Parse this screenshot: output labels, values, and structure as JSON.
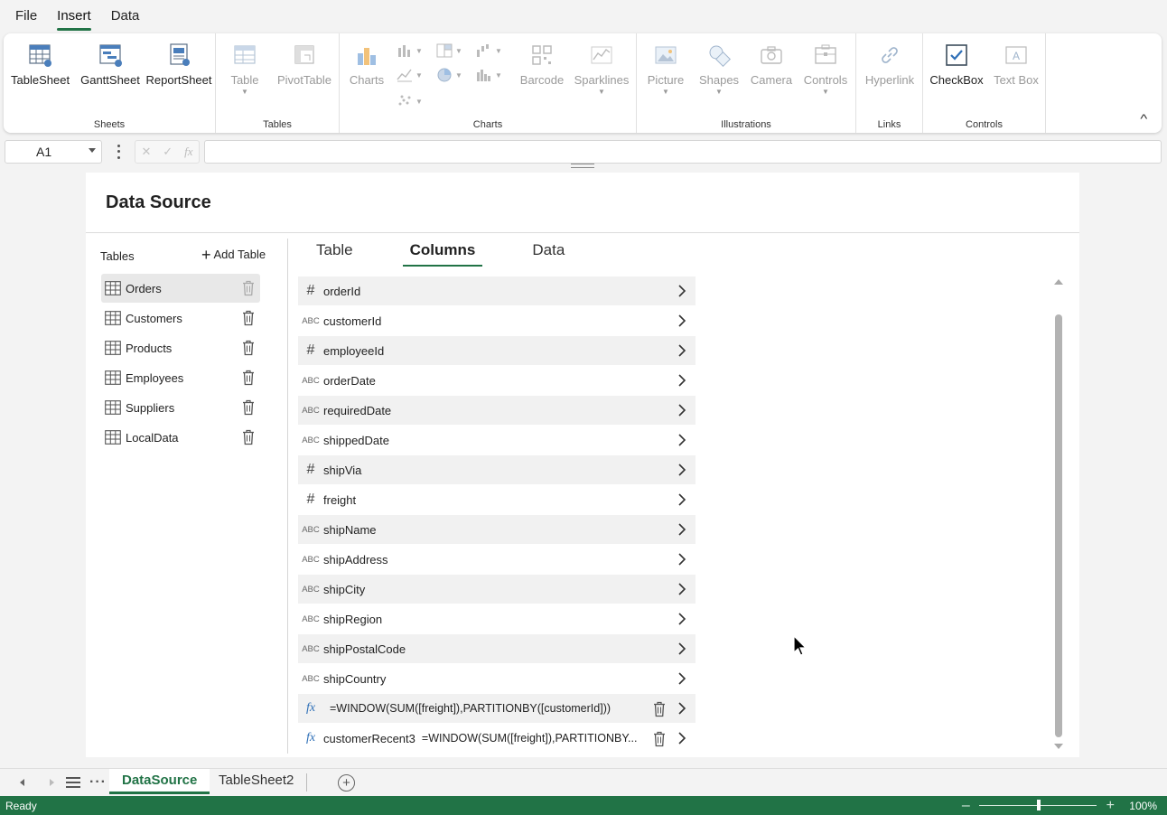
{
  "menu": [
    "File",
    "Insert",
    "Data"
  ],
  "ribbon": {
    "sheets": {
      "group": "Sheets",
      "tablesheet": "TableSheet",
      "ganttsheet": "GanttSheet",
      "reportsheet": "ReportSheet"
    },
    "tables": {
      "group": "Tables",
      "table": "Table",
      "pivottable": "PivotTable"
    },
    "charts": {
      "group": "Charts",
      "charts": "Charts",
      "barcode": "Barcode",
      "sparklines": "Sparklines"
    },
    "illustrations": {
      "group": "Illustrations",
      "picture": "Picture",
      "shapes": "Shapes",
      "camera": "Camera",
      "controls": "Controls"
    },
    "links": {
      "group": "Links",
      "hyperlink": "Hyperlink"
    },
    "controls": {
      "group": "Controls",
      "checkbox": "CheckBox",
      "textbox": "Text Box"
    },
    "collapse_icon": "chevron-up-icon"
  },
  "formula_bar": {
    "cell_ref": "A1",
    "formula": ""
  },
  "data_source": {
    "title": "Data Source",
    "tables_label": "Tables",
    "add_table": "Add Table",
    "tables": [
      "Orders",
      "Customers",
      "Products",
      "Employees",
      "Suppliers",
      "LocalData"
    ],
    "selected_table": "Orders",
    "tabs": [
      "Table",
      "Columns",
      "Data"
    ],
    "active_tab": "Columns",
    "columns": [
      {
        "type": "#",
        "name": "orderId"
      },
      {
        "type": "ABC",
        "name": "customerId"
      },
      {
        "type": "#",
        "name": "employeeId"
      },
      {
        "type": "ABC",
        "name": "orderDate"
      },
      {
        "type": "ABC",
        "name": "requiredDate"
      },
      {
        "type": "ABC",
        "name": "shippedDate"
      },
      {
        "type": "#",
        "name": "shipVia"
      },
      {
        "type": "#",
        "name": "freight"
      },
      {
        "type": "ABC",
        "name": "shipName"
      },
      {
        "type": "ABC",
        "name": "shipAddress"
      },
      {
        "type": "ABC",
        "name": "shipCity"
      },
      {
        "type": "ABC",
        "name": "shipRegion"
      },
      {
        "type": "ABC",
        "name": "shipPostalCode"
      },
      {
        "type": "ABC",
        "name": "shipCountry"
      },
      {
        "type": "fx",
        "name": "",
        "formula": "=WINDOW(SUM([freight]),PARTITIONBY([customerId]))"
      },
      {
        "type": "fx",
        "name": "customerRecent3",
        "formula": "=WINDOW(SUM([freight]),PARTITIONBY..."
      }
    ]
  },
  "sheet_tabs": [
    "DataSource",
    "TableSheet2"
  ],
  "active_sheet": "DataSource",
  "status": {
    "text": "Ready",
    "zoom": "100%",
    "zoom_minus": "–",
    "zoom_plus": "+"
  },
  "colors": {
    "accent": "#217346",
    "background": "#f3f3f3"
  }
}
